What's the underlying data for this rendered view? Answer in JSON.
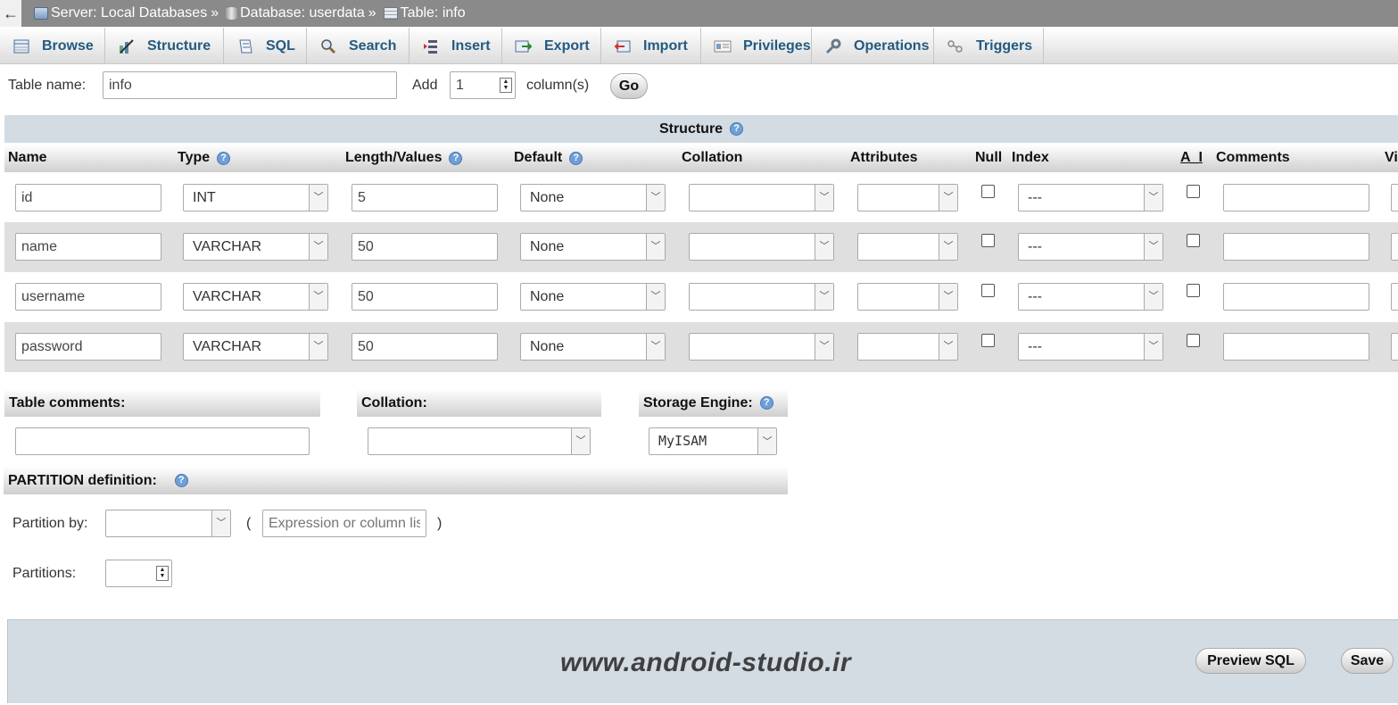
{
  "breadcrumb": {
    "back": "←",
    "server": "Server: Local Databases",
    "database": "Database: userdata",
    "table": "Table: info",
    "sep": "»"
  },
  "tabs": [
    {
      "label": "Browse",
      "icon": "browse-icon"
    },
    {
      "label": "Structure",
      "icon": "structure-icon"
    },
    {
      "label": "SQL",
      "icon": "sql-icon"
    },
    {
      "label": "Search",
      "icon": "search-icon"
    },
    {
      "label": "Insert",
      "icon": "insert-icon"
    },
    {
      "label": "Export",
      "icon": "export-icon"
    },
    {
      "label": "Import",
      "icon": "import-icon"
    },
    {
      "label": "Privileges",
      "icon": "privileges-icon"
    },
    {
      "label": "Operations",
      "icon": "operations-icon"
    },
    {
      "label": "Triggers",
      "icon": "triggers-icon"
    }
  ],
  "form": {
    "table_name_label": "Table name:",
    "table_name_value": "info",
    "add_label": "Add",
    "add_value": "1",
    "columns_label": "column(s)",
    "go": "Go"
  },
  "structure": {
    "title": "Structure",
    "headers": {
      "name": "Name",
      "type": "Type",
      "length": "Length/Values",
      "default": "Default",
      "collation": "Collation",
      "attributes": "Attributes",
      "null": "Null",
      "index": "Index",
      "ai": "A_I",
      "comments": "Comments",
      "virtuality": "Vi"
    },
    "rows": [
      {
        "name": "id",
        "type": "INT",
        "length": "5",
        "default": "None",
        "collation": "",
        "attributes": "",
        "null": false,
        "index": "---",
        "ai": false,
        "comments": ""
      },
      {
        "name": "name",
        "type": "VARCHAR",
        "length": "50",
        "default": "None",
        "collation": "",
        "attributes": "",
        "null": false,
        "index": "---",
        "ai": false,
        "comments": ""
      },
      {
        "name": "username",
        "type": "VARCHAR",
        "length": "50",
        "default": "None",
        "collation": "",
        "attributes": "",
        "null": false,
        "index": "---",
        "ai": false,
        "comments": ""
      },
      {
        "name": "password",
        "type": "VARCHAR",
        "length": "50",
        "default": "None",
        "collation": "",
        "attributes": "",
        "null": false,
        "index": "---",
        "ai": false,
        "comments": ""
      }
    ]
  },
  "table_options": {
    "comments_label": "Table comments:",
    "comments_value": "",
    "collation_label": "Collation:",
    "collation_value": "",
    "engine_label": "Storage Engine:",
    "engine_value": "MyISAM"
  },
  "partition": {
    "title": "PARTITION definition:",
    "by_label": "Partition by:",
    "by_value": "",
    "open_paren": "(",
    "close_paren": ")",
    "expression_placeholder": "Expression or column list",
    "partitions_label": "Partitions:",
    "partitions_value": ""
  },
  "footer": {
    "watermark": "www.android-studio.ir",
    "preview_sql": "Preview SQL",
    "save": "Save"
  }
}
